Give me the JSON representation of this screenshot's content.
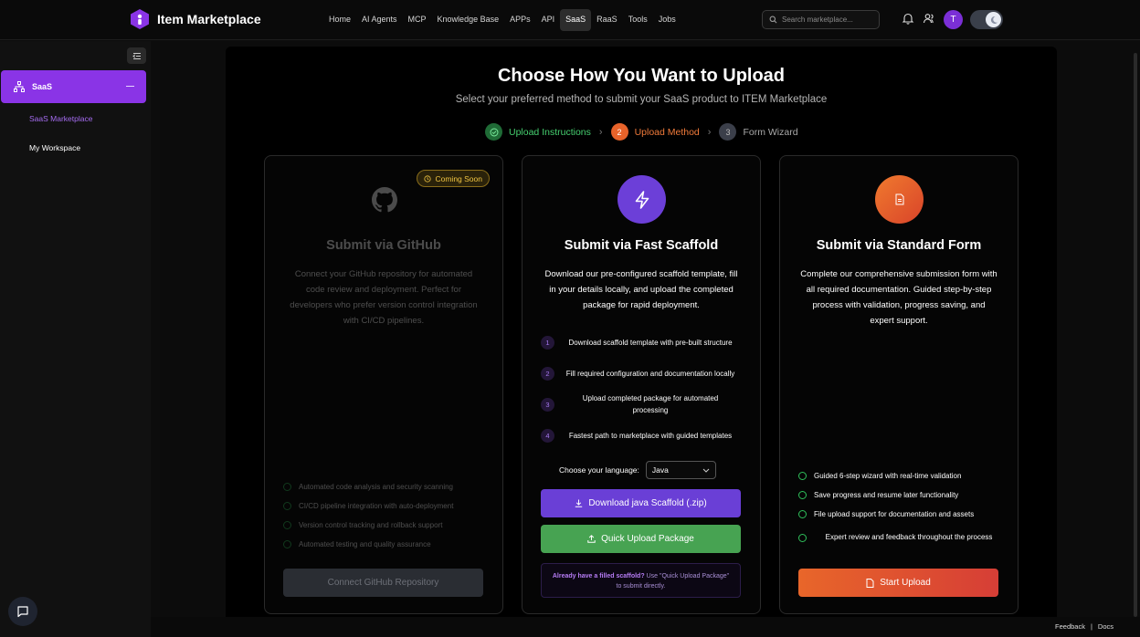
{
  "app": {
    "name": "Item Marketplace"
  },
  "nav": [
    {
      "label": "Home",
      "active": false
    },
    {
      "label": "AI Agents",
      "active": false
    },
    {
      "label": "MCP",
      "active": false
    },
    {
      "label": "Knowledge Base",
      "active": false
    },
    {
      "label": "APPs",
      "active": false
    },
    {
      "label": "API",
      "active": false
    },
    {
      "label": "SaaS",
      "active": true
    },
    {
      "label": "RaaS",
      "active": false
    },
    {
      "label": "Tools",
      "active": false
    },
    {
      "label": "Jobs",
      "active": false
    }
  ],
  "search": {
    "placeholder": "Search marketplace..."
  },
  "user": {
    "initial": "T"
  },
  "sidebar": {
    "active_section": "SaaS",
    "items": [
      {
        "label": "SaaS Marketplace",
        "selected": true
      },
      {
        "label": "My Workspace",
        "selected": false
      }
    ]
  },
  "main": {
    "title": "Choose How You Want to Upload",
    "subtitle": "Select your preferred method to submit your SaaS product to ITEM Marketplace",
    "steps": [
      {
        "number": "",
        "label": "Upload Instructions",
        "status": "done"
      },
      {
        "number": "2",
        "label": "Upload Method",
        "status": "current"
      },
      {
        "number": "3",
        "label": "Form Wizard",
        "status": "upcoming"
      }
    ]
  },
  "cards": {
    "github": {
      "badge": "Coming Soon",
      "title": "Submit via GitHub",
      "description": "Connect your GitHub repository for automated code review and deployment. Perfect for developers who prefer version control integration with CI/CD pipelines.",
      "features": [
        "Automated code analysis and security scanning",
        "CI/CD pipeline integration with auto-deployment",
        "Version control tracking and rollback support",
        "Automated testing and quality assurance"
      ],
      "button": "Connect GitHub Repository"
    },
    "scaffold": {
      "title": "Submit via Fast Scaffold",
      "description": "Download our pre-configured scaffold template, fill in your details locally, and upload the completed package for rapid deployment.",
      "steps": [
        {
          "n": "1",
          "text": "Download scaffold template with pre-built structure"
        },
        {
          "n": "2",
          "text": "Fill required configuration and documentation locally"
        },
        {
          "n": "3",
          "text": "Upload completed package for automated processing"
        },
        {
          "n": "4",
          "text": "Fastest path to marketplace with guided templates"
        }
      ],
      "language_label": "Choose your language:",
      "language_value": "Java",
      "download_button": "Download java Scaffold (.zip)",
      "upload_button": "Quick Upload Package",
      "note_bold": "Already have a filled scaffold?",
      "note_text": "Use \"Quick Upload Package\" to submit directly."
    },
    "standard": {
      "title": "Submit via Standard Form",
      "description": "Complete our comprehensive submission form with all required documentation. Guided step-by-step process with validation, progress saving, and expert support.",
      "features": [
        "Guided 6-step wizard with real-time validation",
        "Save progress and resume later functionality",
        "File upload support for documentation and assets",
        "Expert review and feedback throughout the process"
      ],
      "button": "Start Upload"
    }
  },
  "footer": {
    "feedback": "Feedback",
    "separator": "|",
    "docs": "Docs"
  },
  "colors": {
    "accent": "#8a34e6",
    "green": "#4caf50",
    "orange": "#e8632a",
    "gold": "#f1c542"
  }
}
